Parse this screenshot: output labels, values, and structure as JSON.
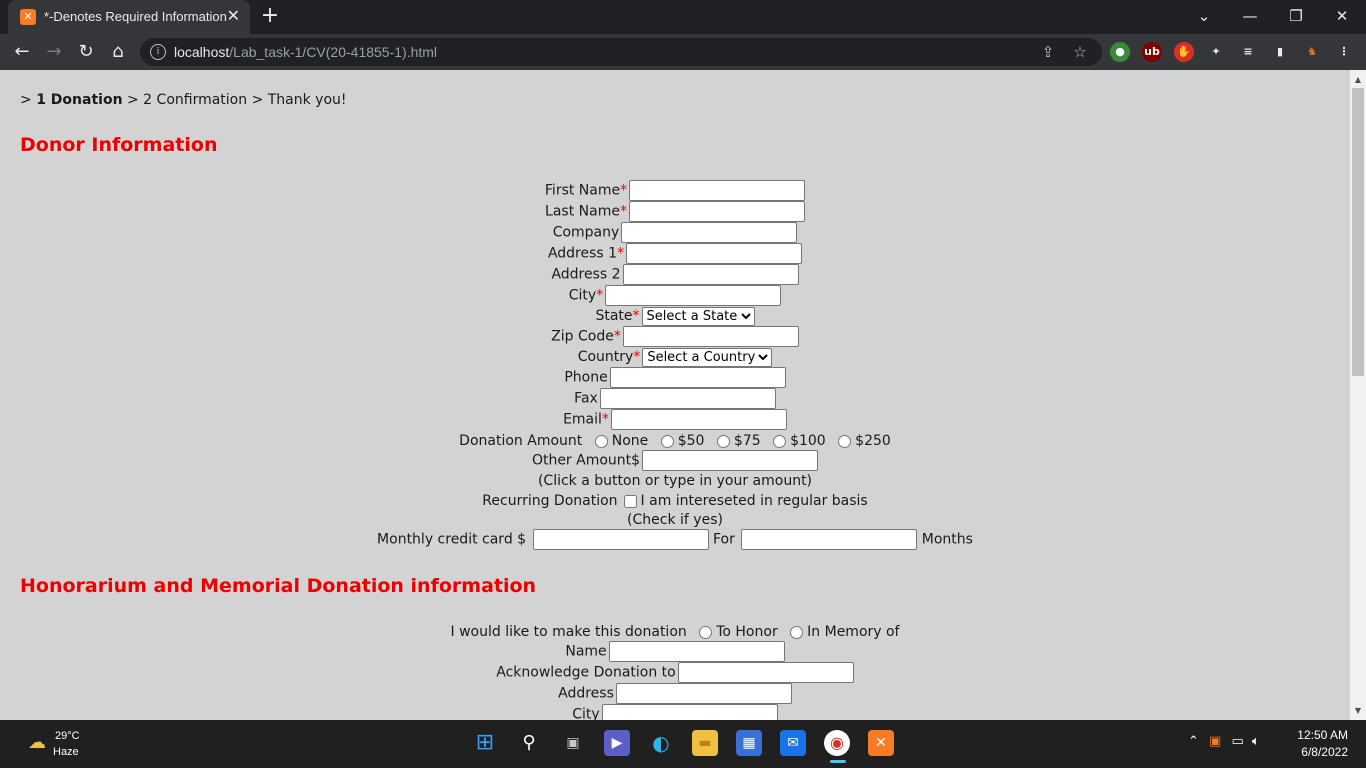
{
  "browser": {
    "tab_title": "*-Denotes Required Information",
    "favicon_letter": "ꭒ",
    "url_host": "localhost",
    "url_path": "/Lab_task-1/CV(20-41855-1).html"
  },
  "page": {
    "breadcrumb": {
      "prefix": ">",
      "step1": "1 Donation",
      "rest": "> 2 Confirmation > Thank you!"
    },
    "donor_heading": "Donor Information",
    "required_mark": "*",
    "fields": {
      "first_name": "First Name",
      "last_name": "Last Name",
      "company": "Company",
      "address1": "Address 1",
      "address2": "Address 2",
      "city": "City",
      "state": "State",
      "state_select": "Select a State",
      "zip": "Zip Code",
      "country": "Country",
      "country_select": "Select a Country",
      "phone": "Phone",
      "fax": "Fax",
      "email": "Email"
    },
    "donation": {
      "label": "Donation Amount",
      "options": [
        "None",
        "$50",
        "$75",
        "$100",
        "$250"
      ],
      "other_label": "Other Amount$",
      "hint": "(Click a button or type in your amount)",
      "recurring_label": "Recurring Donation",
      "recurring_option": "I am intereseted in regular basis",
      "recurring_hint": "(Check if yes)",
      "monthly_label": "Monthly credit card $",
      "for_label": "For",
      "months_label": "Months"
    },
    "honor_heading": "Honorarium and Memorial Donation information",
    "honor": {
      "intro": "I would like to make this donation",
      "to_honor": "To Honor",
      "in_memory": "In Memory of",
      "name": "Name",
      "acknowledge": "Acknowledge Donation to",
      "address": "Address",
      "city": "City"
    }
  },
  "taskbar": {
    "temperature": "29°C",
    "condition": "Haze",
    "time": "12:50 AM",
    "date": "6/8/2022"
  },
  "colors": {
    "heading_red": "#ee0000",
    "page_bg": "#d3d3d3",
    "chrome_dark": "#202124",
    "chrome_toolbar": "#35363a"
  }
}
